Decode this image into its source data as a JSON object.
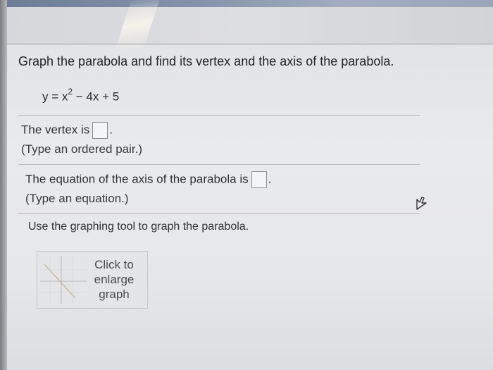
{
  "question": {
    "title": "Graph the parabola and find its vertex and the axis of the parabola.",
    "equation": {
      "lhs": "y = x",
      "exponent": "2",
      "rhs": " − 4x + 5"
    }
  },
  "vertex": {
    "prompt": "The vertex is",
    "suffix": ".",
    "hint": "(Type an ordered pair.)",
    "value": ""
  },
  "axis": {
    "prompt": "The equation of the axis of the parabola is",
    "suffix": ".",
    "hint": "(Type an equation.)",
    "value": ""
  },
  "graph": {
    "instruction": "Use the graphing tool to graph the parabola.",
    "button_label": "Click to\nenlarge\ngraph",
    "thumbnail_icon": "graph-thumbnail-icon"
  },
  "icons": {
    "cursor": "pointer-cursor-icon"
  },
  "colors": {
    "text": "#2a2a2e",
    "background": "#e6e7e9",
    "header": "#7a879e"
  }
}
